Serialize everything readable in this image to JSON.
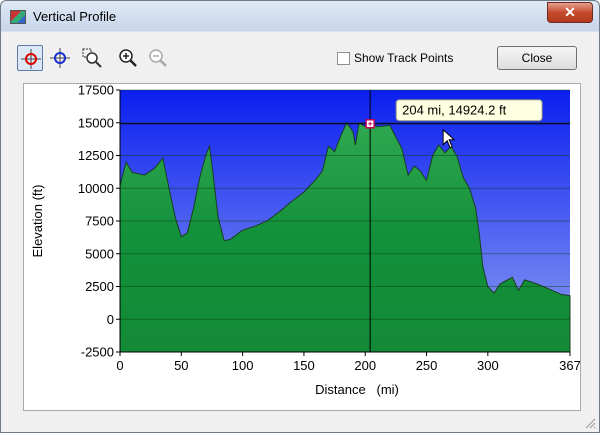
{
  "window": {
    "title": "Vertical Profile",
    "close_glyph": "✕"
  },
  "toolbar": {
    "tools": [
      {
        "name": "crosshair-red-icon",
        "active": true
      },
      {
        "name": "crosshair-blue-icon",
        "active": false
      },
      {
        "name": "zoom-region-icon",
        "active": false
      },
      {
        "name": "zoom-in-icon",
        "active": false
      },
      {
        "name": "zoom-out-icon",
        "active": false
      }
    ],
    "show_track_points_label": "Show Track Points",
    "show_track_points_checked": false,
    "close_label": "Close"
  },
  "colors": {
    "sky_top": "#0a1ff0",
    "sky_bottom": "#8fa0f2",
    "terrain": "#159a3e",
    "terrain_stroke": "#1b3d22"
  },
  "chart_data": {
    "type": "area",
    "xlabel": "Distance   (mi)",
    "ylabel": "Elevation (ft)",
    "xlim": [
      0,
      367
    ],
    "ylim": [
      -2500,
      17500
    ],
    "x_ticks": [
      "0",
      "50",
      "100",
      "150",
      "200",
      "250",
      "300",
      "367"
    ],
    "x_tick_values": [
      0,
      50,
      100,
      150,
      200,
      250,
      300,
      367
    ],
    "y_ticks": [
      "17500",
      "15000",
      "12500",
      "10000",
      "7500",
      "5000",
      "2500",
      "0",
      "-2500"
    ],
    "y_tick_values": [
      17500,
      15000,
      12500,
      10000,
      7500,
      5000,
      2500,
      0,
      -2500
    ],
    "grid": true,
    "cursor": {
      "x": 204,
      "y": 14924.2,
      "label": "204 mi, 14924.2 ft"
    },
    "x": [
      0,
      5,
      10,
      20,
      28,
      35,
      40,
      45,
      50,
      55,
      60,
      65,
      70,
      73,
      76,
      80,
      85,
      90,
      100,
      110,
      120,
      130,
      140,
      150,
      160,
      165,
      170,
      175,
      180,
      185,
      190,
      192,
      195,
      200,
      204,
      210,
      220,
      230,
      235,
      240,
      245,
      250,
      255,
      260,
      265,
      270,
      275,
      280,
      285,
      290,
      293,
      296,
      300,
      305,
      310,
      320,
      325,
      330,
      340,
      350,
      360,
      367
    ],
    "values": [
      10200,
      12000,
      11200,
      11000,
      11500,
      12300,
      10000,
      7800,
      6300,
      6600,
      8500,
      10800,
      12500,
      13200,
      11000,
      7800,
      6000,
      6100,
      6800,
      7100,
      7500,
      8200,
      9000,
      9700,
      10700,
      11300,
      13200,
      12800,
      14000,
      15000,
      14300,
      13300,
      15000,
      14700,
      14924.2,
      14700,
      14800,
      13000,
      11000,
      11700,
      11300,
      10600,
      12500,
      13300,
      12700,
      13200,
      12400,
      10800,
      10000,
      8500,
      6500,
      4000,
      2500,
      2000,
      2700,
      3200,
      2200,
      3000,
      2700,
      2300,
      1900,
      1800
    ]
  }
}
